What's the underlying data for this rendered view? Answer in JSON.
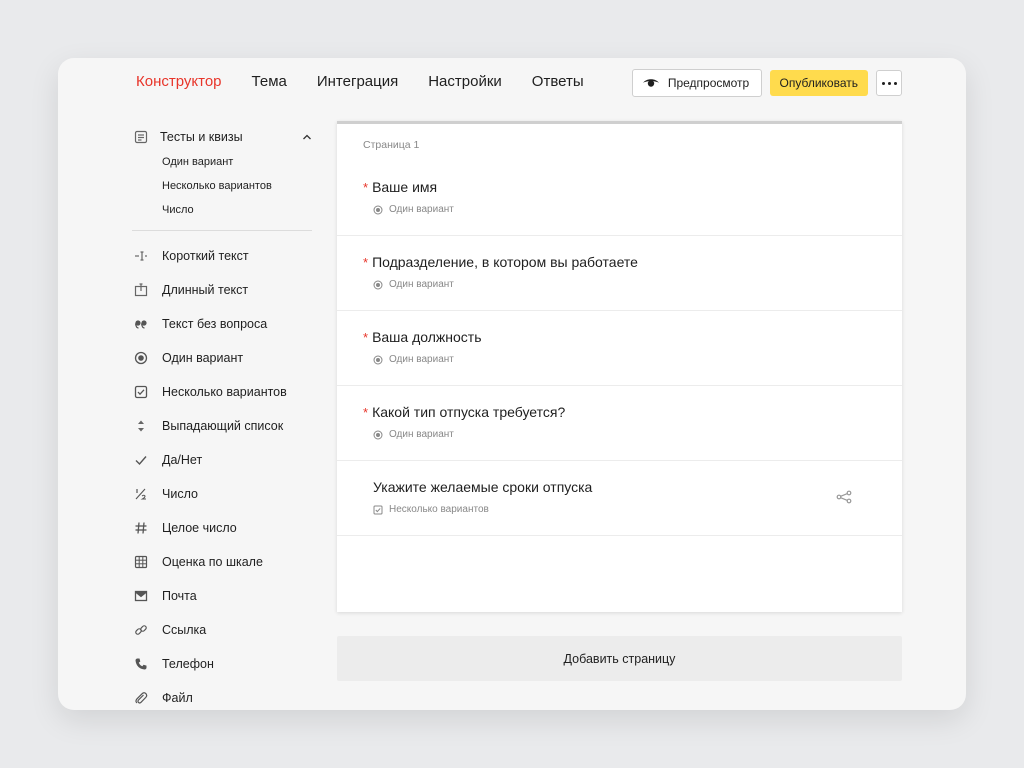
{
  "header": {
    "nav": [
      {
        "label": "Конструктор",
        "active": true
      },
      {
        "label": "Тема"
      },
      {
        "label": "Интеграция"
      },
      {
        "label": "Настройки"
      },
      {
        "label": "Ответы"
      }
    ],
    "preview_label": "Предпросмотр",
    "publish_label": "Опубликовать"
  },
  "sidebar": {
    "group": {
      "label": "Тесты и квизы",
      "items": [
        "Один вариант",
        "Несколько вариантов",
        "Число"
      ]
    },
    "items": [
      {
        "label": "Короткий текст",
        "icon": "short-text-icon"
      },
      {
        "label": "Длинный текст",
        "icon": "long-text-icon"
      },
      {
        "label": "Текст без вопроса",
        "icon": "quote-icon"
      },
      {
        "label": "Один вариант",
        "icon": "radio-icon"
      },
      {
        "label": "Несколько вариантов",
        "icon": "checkbox-icon"
      },
      {
        "label": "Выпадающий список",
        "icon": "dropdown-icon"
      },
      {
        "label": "Да/Нет",
        "icon": "check-icon"
      },
      {
        "label": "Число",
        "icon": "fraction-icon"
      },
      {
        "label": "Целое число",
        "icon": "hash-icon"
      },
      {
        "label": "Оценка по шкале",
        "icon": "grid-icon"
      },
      {
        "label": "Почта",
        "icon": "mail-icon"
      },
      {
        "label": "Ссылка",
        "icon": "link-icon"
      },
      {
        "label": "Телефон",
        "icon": "phone-icon"
      },
      {
        "label": "Файл",
        "icon": "paperclip-icon"
      }
    ]
  },
  "form": {
    "page_label": "Страница 1",
    "required_mark": "*",
    "questions": [
      {
        "title": "Ваше имя",
        "type": "Один вариант",
        "required": true
      },
      {
        "title": "Подразделение, в котором вы работаете",
        "type": "Один вариант",
        "required": true
      },
      {
        "title": "Ваша должность",
        "type": "Один вариант",
        "required": true
      },
      {
        "title": "Какой тип отпуска требуется?",
        "type": "Один вариант",
        "required": true
      },
      {
        "title": "Укажите желаемые сроки отпуска",
        "type": "Несколько вариантов",
        "required": false
      }
    ],
    "add_page_label": "Добавить страницу"
  },
  "colors": {
    "accent": "#e8352a",
    "publish": "#ffdb4d"
  }
}
